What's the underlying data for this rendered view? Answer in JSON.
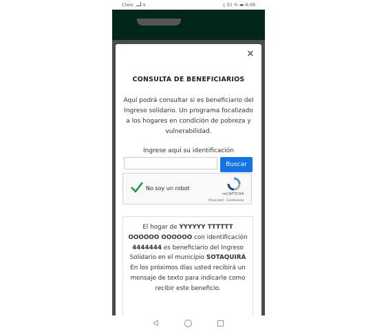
{
  "statusbar": {
    "carrier": "Claro",
    "battery": "51 %",
    "time": "6:08"
  },
  "modal": {
    "close_label": "×",
    "title": "CONSULTA DE BENEFICIARIOS",
    "description": "Aquí podrá consultar si es beneficiario del Ingreso solidario. Un programa focalizado a los hogares en condición de pobreza y vulnerabilidad.",
    "id_label": "Ingrese aquí su identificación",
    "id_value": "",
    "search_label": "Buscar"
  },
  "captcha": {
    "label": "No soy un robot",
    "brand": "reCAPTCHA",
    "links": "Privacidad - Condiciones"
  },
  "result": {
    "p1": "El hogar de ",
    "name": "YYYYYY TTTTTT OOOOOO OOOOOO",
    "p2": " con identificación ",
    "id": "4444444",
    "p3": " es beneficiario del Ingreso Solidario en el municipio ",
    "municipality": "SOTAQUIRÁ",
    "p4": " En los próximos días usted recibirá un mensaje de texto para indicarle como recibir este beneficio."
  }
}
